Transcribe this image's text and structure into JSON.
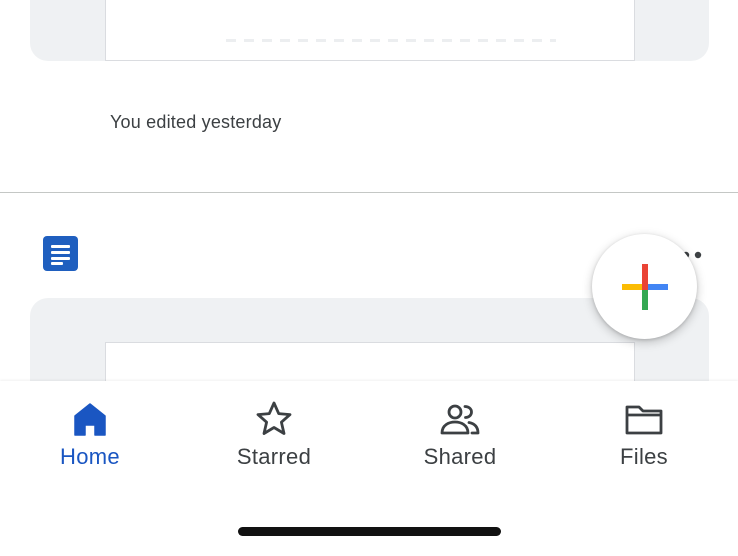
{
  "file_list": {
    "items": [
      {
        "type": "google-doc",
        "activity": "You edited yesterday"
      },
      {
        "type": "google-doc",
        "icon": "docs-icon",
        "menu_icon": "more-vert-icon"
      }
    ]
  },
  "fab": {
    "icon": "plus-multicolor-icon",
    "colors": [
      "#ea4335",
      "#fbbc04",
      "#34a853",
      "#4285f4"
    ]
  },
  "bottom_nav": {
    "items": [
      {
        "label": "Home",
        "icon": "home-icon",
        "active": true
      },
      {
        "label": "Starred",
        "icon": "star-icon",
        "active": false
      },
      {
        "label": "Shared",
        "icon": "shared-people-icon",
        "active": false
      },
      {
        "label": "Files",
        "icon": "folder-icon",
        "active": false
      }
    ],
    "active_color": "#1a56c2",
    "inactive_color": "#3c4043"
  },
  "colors": {
    "docs_blue": "#1f5fbf",
    "card_bg": "#eff1f3",
    "divider": "#c4c7c5"
  }
}
